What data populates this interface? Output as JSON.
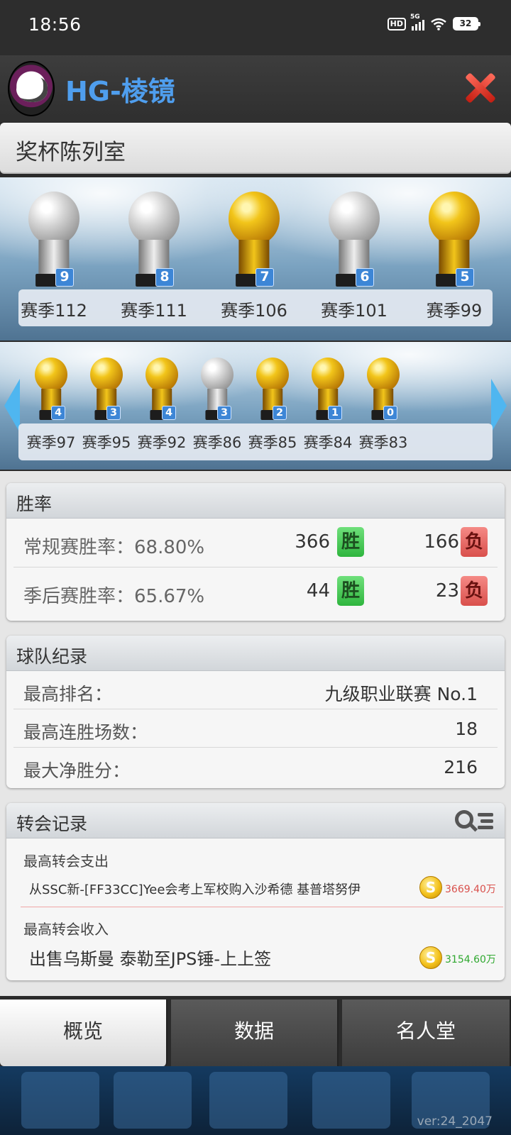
{
  "status_bar": {
    "time": "18:56",
    "hd": "HD",
    "network": "5G",
    "battery": "32"
  },
  "header": {
    "team_name": "HG-棱镜"
  },
  "trophy_room": {
    "title": "奖杯陈列室",
    "row1": [
      {
        "type": "silver",
        "count": "9",
        "season": "赛季112"
      },
      {
        "type": "silver",
        "count": "8",
        "season": "赛季111"
      },
      {
        "type": "gold",
        "count": "7",
        "season": "赛季106"
      },
      {
        "type": "silver",
        "count": "6",
        "season": "赛季101"
      },
      {
        "type": "gold",
        "count": "5",
        "season": "赛季99"
      }
    ],
    "row2": [
      {
        "type": "gold",
        "count": "4",
        "season": "赛季97"
      },
      {
        "type": "gold",
        "count": "3",
        "season": "赛季95"
      },
      {
        "type": "gold",
        "count": "4",
        "season": "赛季92"
      },
      {
        "type": "silver",
        "count": "3",
        "season": "赛季86"
      },
      {
        "type": "gold",
        "count": "2",
        "season": "赛季85"
      },
      {
        "type": "gold",
        "count": "1",
        "season": "赛季84"
      },
      {
        "type": "gold",
        "count": "0",
        "season": "赛季83"
      }
    ]
  },
  "win_rate": {
    "title": "胜率",
    "rows": [
      {
        "label": "常规赛胜率：68.80%",
        "wins": "366",
        "win_badge": "胜",
        "losses": "166",
        "loss_badge": "负"
      },
      {
        "label": "季后赛胜率：65.67%",
        "wins": "44",
        "win_badge": "胜",
        "losses": "23",
        "loss_badge": "负"
      }
    ]
  },
  "team_record": {
    "title": "球队纪录",
    "rows": [
      {
        "label": "最高排名：",
        "value": "九级职业联赛 No.1"
      },
      {
        "label": "最高连胜场数：",
        "value": "18"
      },
      {
        "label": "最大净胜分：",
        "value": "216"
      }
    ]
  },
  "transfer_record": {
    "title": "转会记录",
    "spend": {
      "caption": "最高转会支出",
      "desc": "从SSC新-[FF33CC]Yee会考上军校购入沙希德 基普塔努伊",
      "coin": "S",
      "amount": "3669.40万"
    },
    "income": {
      "caption": "最高转会收入",
      "desc": "出售乌斯曼 泰勒至JPS锤-上上签",
      "coin": "S",
      "amount": "3154.60万"
    }
  },
  "tabs": [
    "概览",
    "数据",
    "名人堂"
  ],
  "footer": {
    "version": "ver:24_2047"
  },
  "colors": {
    "accent": "#4f9eee",
    "win": "#2fb53e",
    "loss": "#d9504c",
    "spend": "#d9504c",
    "income": "#2fa82f"
  }
}
